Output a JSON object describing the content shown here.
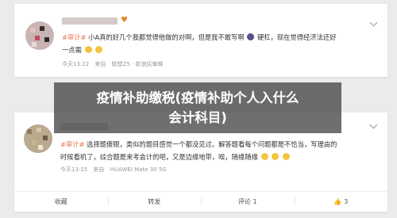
{
  "post1": {
    "name_tail": "♥",
    "line1": "#审计# 小A真的好几个我都觉得他做的对啊，但是我不敢写啊 硬杠，现在觉得经济法还好",
    "tag": "#审计#",
    "line1_rest": "小A真的好几个我都觉得他做的对啊，但是我不敢写啊",
    "line1_tail": "硬杠，现在觉得经济法还好",
    "line2": "一点需",
    "time": "今天13:22",
    "source_prefix": "来自",
    "source": "联想Z5 · 新浪民蜘蛛"
  },
  "post2": {
    "tag": "#审计#",
    "line1_rest": "选择题傻眼，类似的题目感觉一个都没见过。解答题看每个问题都是不恰当，写理由的",
    "line2": "时候看机了，综合题是来考会计的吧，又是边缘地带，唉，随缘随缘",
    "time": "今天13:15",
    "source_prefix": "来自",
    "source": "HUAWEI Mate 30 5G",
    "actions": {
      "favorite": "收藏",
      "repost": "转发",
      "comment": "评论 1",
      "like": "3"
    }
  },
  "overlay": {
    "line1": "疫情补助缴税(疫情补助个人入什么",
    "line2": "会计科目)"
  }
}
